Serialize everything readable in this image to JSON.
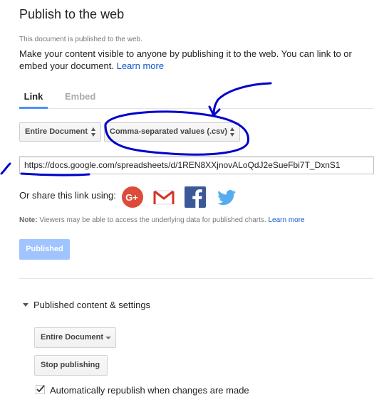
{
  "dialog": {
    "title": "Publish to the web",
    "status": "This document is published to the web.",
    "description": "Make your content visible to anyone by publishing it to the web. You can link to or embed your document.",
    "learn_more": "Learn more"
  },
  "tabs": [
    {
      "label": "Link",
      "active": true
    },
    {
      "label": "Embed",
      "active": false
    }
  ],
  "selects": {
    "scope": "Entire Document",
    "format": "Comma-separated values (.csv)"
  },
  "url": "https://docs.google.com/spreadsheets/d/1REN8XXjnovALoQdJ2eSueFbi7T_DxnS1",
  "share": {
    "label": "Or share this link using:",
    "services": [
      "google-plus-icon",
      "gmail-icon",
      "facebook-icon",
      "twitter-icon"
    ]
  },
  "note": {
    "prefix": "Note:",
    "text": "Viewers may be able to access the underlying data for published charts.",
    "link": "Learn more"
  },
  "published_button": "Published",
  "settings": {
    "header": "Published content & settings",
    "scope_select": "Entire Document",
    "stop_button": "Stop publishing",
    "auto_republish_label": "Automatically republish when changes are made",
    "auto_republish_checked": true
  },
  "colors": {
    "link": "#1155cc",
    "accent_tab": "#4d90fe",
    "published_btn": "#a0c4ff",
    "annotation_ink": "#0000cc"
  }
}
